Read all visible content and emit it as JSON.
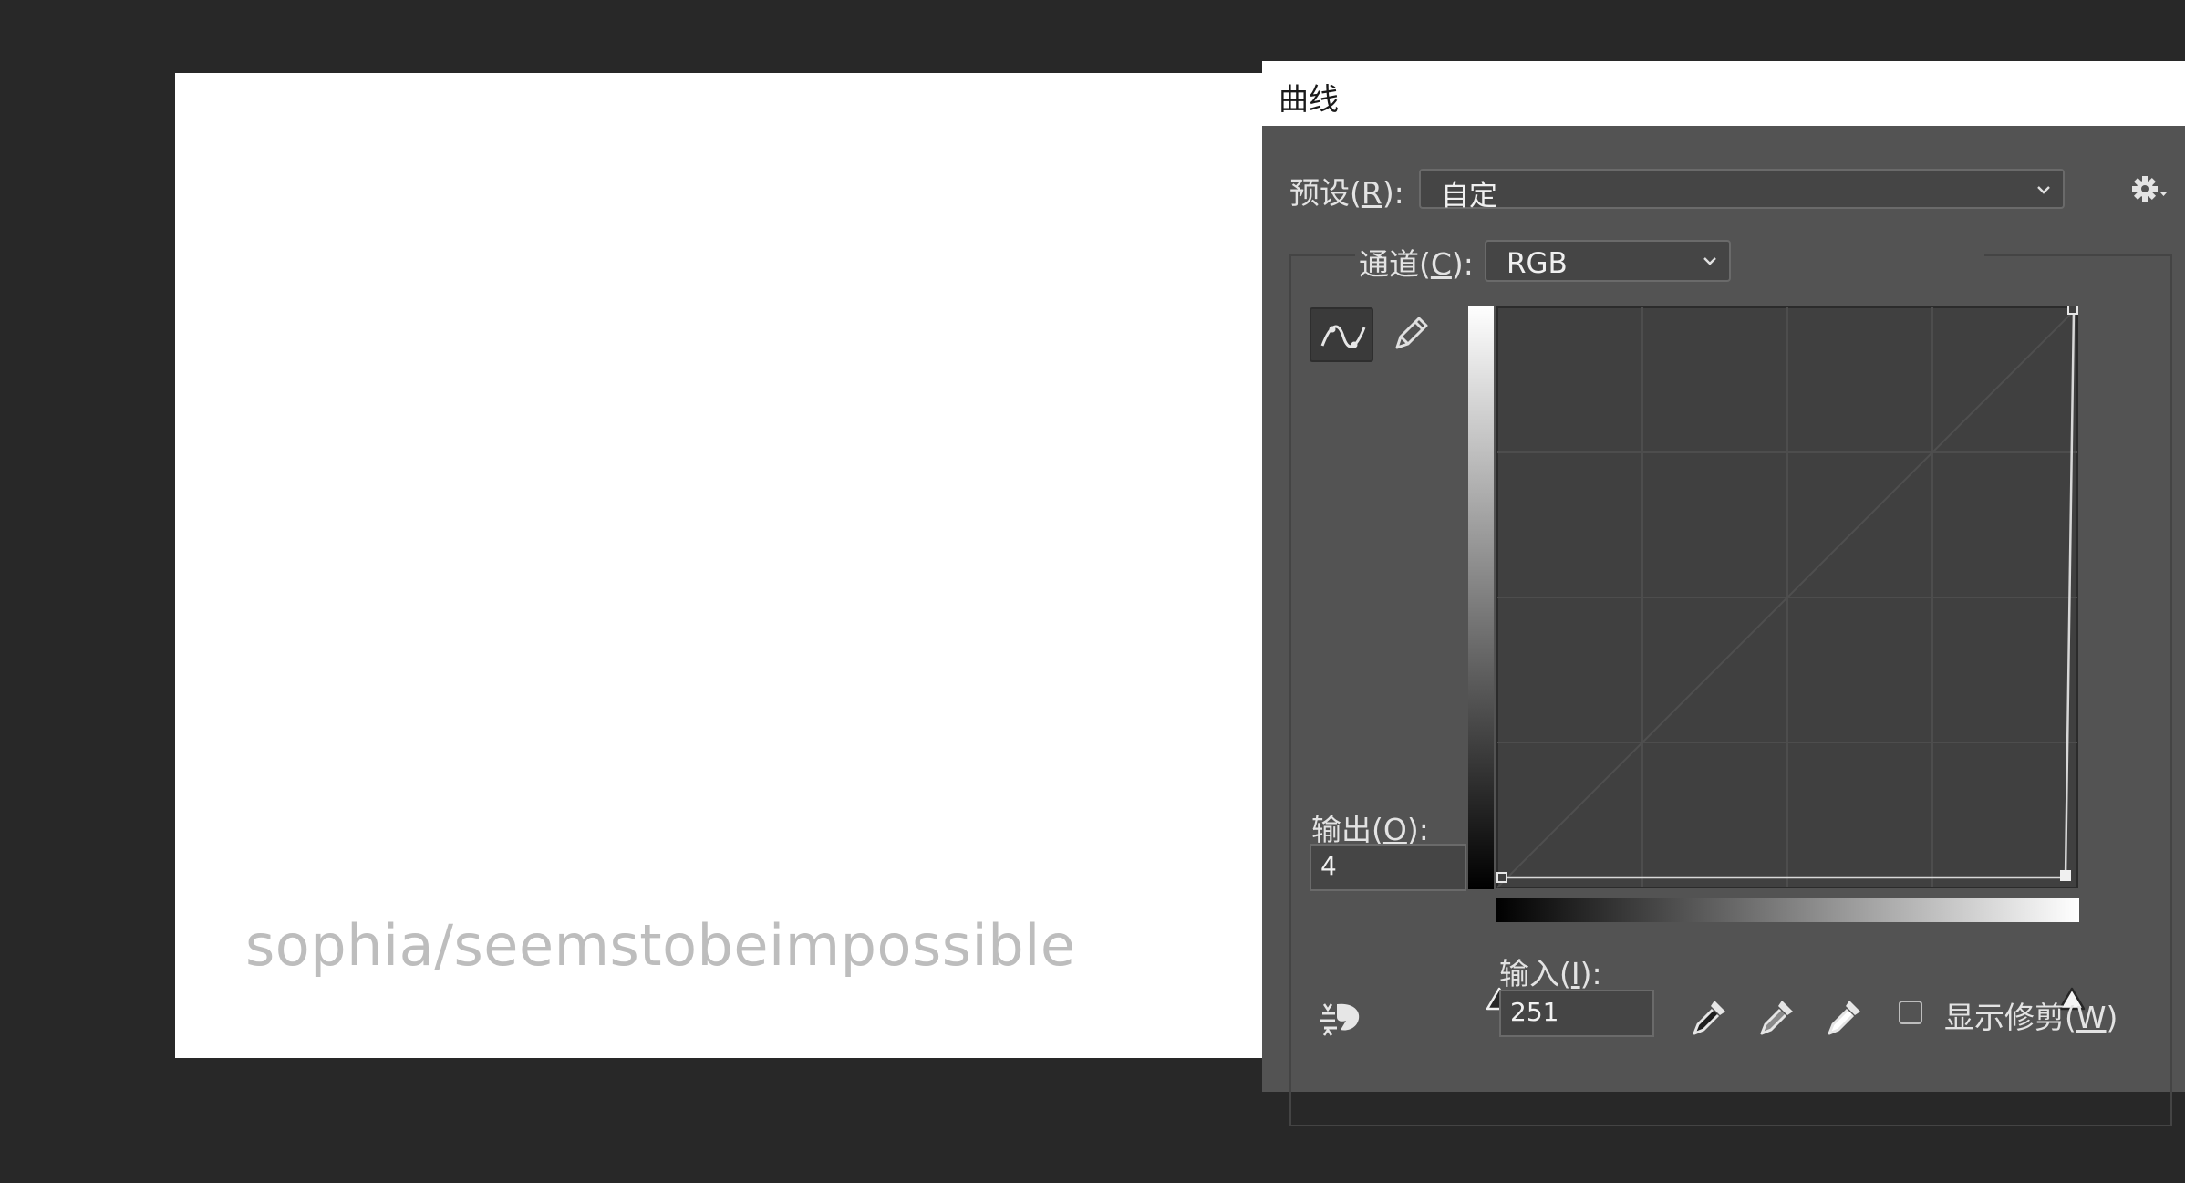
{
  "canvas": {
    "watermark_text": "sophia/seemstobeimpossible"
  },
  "dialog": {
    "title": "曲线",
    "preset": {
      "label_prefix": "预设(",
      "label_key": "R",
      "label_suffix": "):",
      "value": "自定"
    },
    "channel": {
      "label_prefix": "通道(",
      "label_key": "C",
      "label_suffix": "):",
      "value": "RGB"
    },
    "output": {
      "label_prefix": "输出(",
      "label_key": "O",
      "label_suffix": "):",
      "value": "4"
    },
    "input": {
      "label_prefix": "输入(",
      "label_key": "I",
      "label_suffix": "):",
      "value": "251"
    },
    "show_clipping": {
      "label_prefix": "显示修剪(",
      "label_key": "W",
      "label_suffix": ")",
      "checked": false
    },
    "icons": {
      "settings": "gear-icon",
      "curve_tool": "curve-point-tool-icon",
      "pencil_tool": "pencil-icon",
      "auto": "auto-adjust-icon",
      "black_point": "eyedropper-black-icon",
      "gray_point": "eyedropper-gray-icon",
      "white_point": "eyedropper-white-icon"
    },
    "colors": {
      "panel": "#535353",
      "graph_bg": "#404040",
      "curve": "#d8d8d8"
    }
  }
}
